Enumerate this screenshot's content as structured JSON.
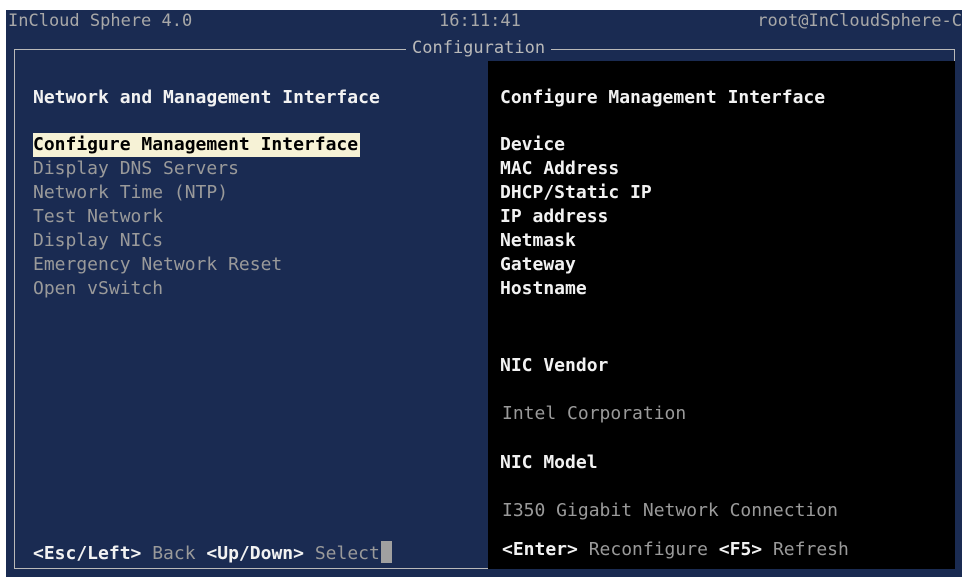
{
  "topbar": {
    "title": "InCloud Sphere 4.0",
    "clock": "16:11:41",
    "user": "root@InCloudSphere-C"
  },
  "dialog": {
    "title": "Configuration"
  },
  "left": {
    "heading": "Network and Management Interface",
    "menu": [
      "Configure Management Interface",
      "Display DNS Servers",
      "Network Time (NTP)",
      "Test Network",
      "Display NICs",
      "Emergency Network Reset",
      "Open vSwitch"
    ],
    "footer": {
      "back_key": "<Esc/Left>",
      "back_label": "Back",
      "select_key": "<Up/Down>",
      "select_label": "Select"
    }
  },
  "right": {
    "heading": "Configure Management Interface",
    "fields": [
      "Device",
      "MAC Address",
      "DHCP/Static IP",
      "IP address",
      "Netmask",
      "Gateway",
      "Hostname"
    ],
    "nic_vendor_label": "NIC Vendor",
    "nic_vendor_value": "Intel Corporation",
    "nic_model_label": "NIC Model",
    "nic_model_value": "I350 Gigabit Network Connection",
    "footer": {
      "reconfigure_key": "<Enter>",
      "reconfigure_label": "Reconfigure",
      "refresh_key": "<F5>",
      "refresh_label": "Refresh"
    }
  },
  "colors": {
    "background_blue": "#1a2b52",
    "highlight": "#f6f2d6",
    "pane_black": "#000000",
    "text_bright": "#f2f2f2",
    "text_dim": "#9a9a9a"
  }
}
